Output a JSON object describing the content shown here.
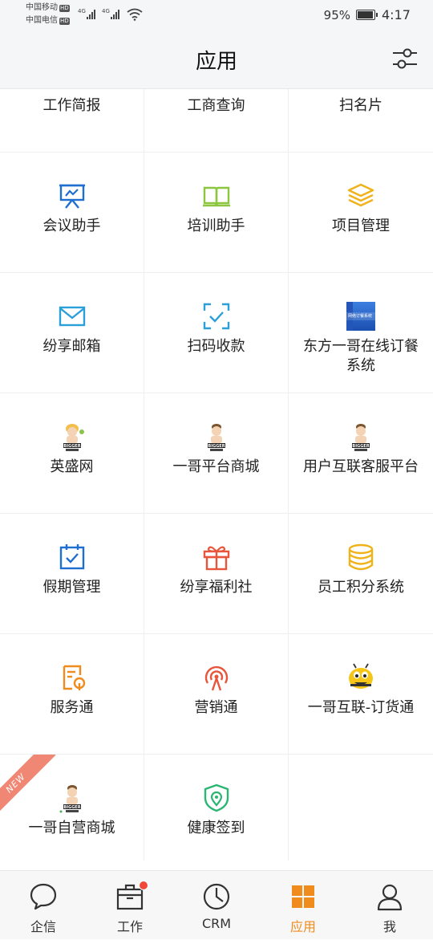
{
  "status_bar": {
    "carrier1": "中国移动",
    "carrier2": "中国电信",
    "hd": "HD",
    "net1": "4G",
    "net2": "4G",
    "battery_pct": "95%",
    "time": "4:17"
  },
  "header": {
    "title": "应用",
    "settings_icon": "sliders-icon"
  },
  "apps": [
    [
      {
        "label": "工作简报"
      },
      {
        "label": "工商查询"
      },
      {
        "label": "扫名片"
      }
    ],
    [
      {
        "label": "会议助手",
        "icon": "presentation-icon",
        "color": "#1f6fd1"
      },
      {
        "label": "培训助手",
        "icon": "open-book-icon",
        "color": "#8cc63f"
      },
      {
        "label": "项目管理",
        "icon": "layers-icon",
        "color": "#f0b21a"
      }
    ],
    [
      {
        "label": "纷享邮箱",
        "icon": "mail-icon",
        "color": "#2a9fd8"
      },
      {
        "label": "扫码收款",
        "icon": "scan-check-icon",
        "color": "#2a9fd8"
      },
      {
        "label": "东方一哥在线订餐系统",
        "icon": "app-thumbnail-icon",
        "color": "#2f6fd6",
        "thumb_text": "网络订餐系统"
      }
    ],
    [
      {
        "label": "英盛网",
        "icon": "mascot-icon"
      },
      {
        "label": "一哥平台商城",
        "icon": "mascot-icon"
      },
      {
        "label": "用户互联客服平台",
        "icon": "mascot-icon"
      }
    ],
    [
      {
        "label": "假期管理",
        "icon": "calendar-check-icon",
        "color": "#1f6fd1"
      },
      {
        "label": "纷享福利社",
        "icon": "gift-icon",
        "color": "#e8553a"
      },
      {
        "label": "员工积分系统",
        "icon": "database-icon",
        "color": "#f0b21a"
      }
    ],
    [
      {
        "label": "服务通",
        "icon": "service-wrench-icon",
        "color": "#f08b1d"
      },
      {
        "label": "营销通",
        "icon": "broadcast-icon",
        "color": "#e8553a"
      },
      {
        "label": "一哥互联-订货通",
        "icon": "bee-icon",
        "color": "#f5c518"
      }
    ],
    [
      {
        "label": "一哥自营商城",
        "icon": "mascot-icon",
        "badge": "NEW"
      },
      {
        "label": "健康签到",
        "icon": "shield-location-icon",
        "color": "#2bb673"
      },
      {
        "label": ""
      }
    ]
  ],
  "mascot_text": "BIGGER",
  "tabbar": {
    "tabs": [
      {
        "label": "企信",
        "icon": "chat-bubble-icon"
      },
      {
        "label": "工作",
        "icon": "briefcase-icon",
        "has_badge": true
      },
      {
        "label": "CRM",
        "icon": "clock-icon"
      },
      {
        "label": "应用",
        "icon": "grid-apps-icon",
        "active": true
      },
      {
        "label": "我",
        "icon": "user-icon"
      }
    ],
    "active_color": "#f08b1d"
  }
}
